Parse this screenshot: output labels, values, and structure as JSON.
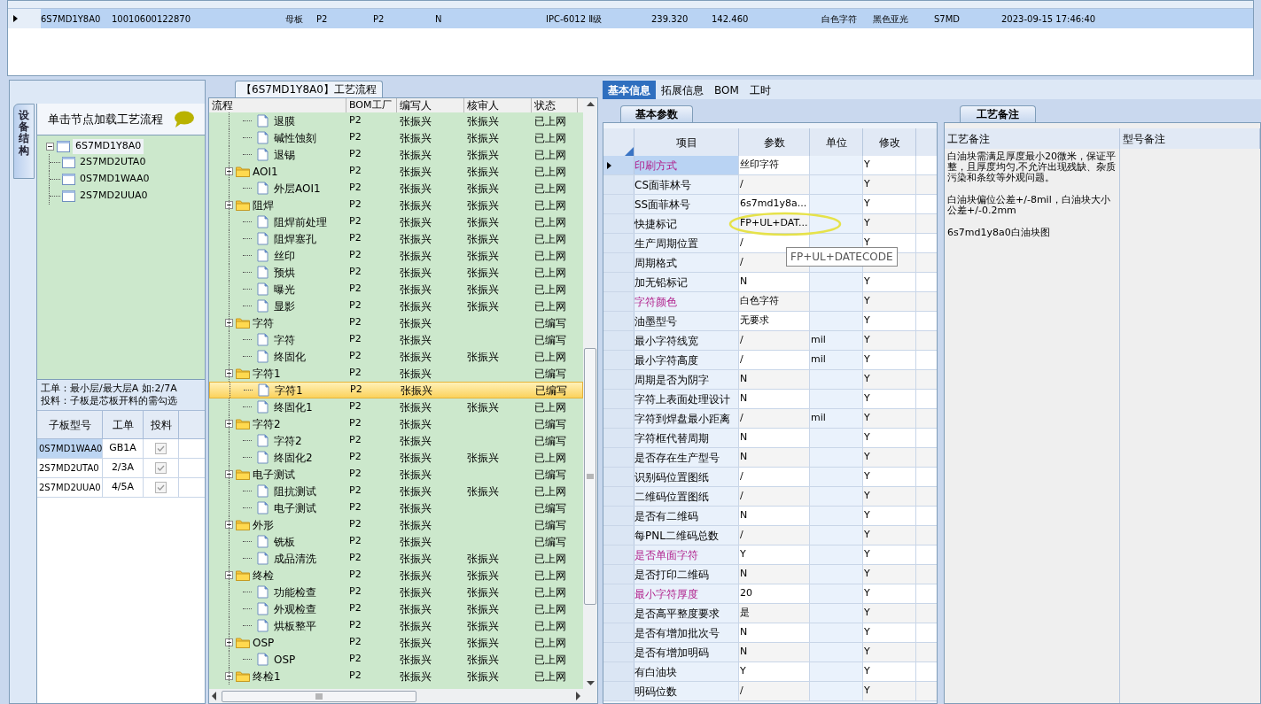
{
  "top_grid": {
    "rows": [
      {
        "selected": true,
        "cells": [
          "6S7MD1Y8A0",
          "10010600122870",
          "母板",
          "P2",
          "P2",
          "N",
          "IPC-6012 Ⅱ级",
          "239.320",
          "142.460",
          "白色字符",
          "黑色亚光",
          "S7MD",
          "2023-09-15 17:46:40"
        ]
      }
    ]
  },
  "left_panel": {
    "tab_label": "设备结构",
    "header": "单击节点加载工艺流程",
    "tree": {
      "label": "6S7MD1Y8A0",
      "expanded": true,
      "children": [
        {
          "label": "2S7MD2UTA0"
        },
        {
          "label": "0S7MD1WAA0"
        },
        {
          "label": "2S7MD2UUA0"
        }
      ]
    },
    "notes": [
      "工单：最小层/最大层A 如:2/7A",
      "投料：子板是芯板开料的需勾选"
    ],
    "subtable": {
      "columns": [
        "子板型号",
        "工单",
        "投料"
      ],
      "rows": [
        {
          "model": "0S7MD1WAA0",
          "order": "GB1A",
          "feed": true,
          "selected": true
        },
        {
          "model": "2S7MD2UTA0",
          "order": "2/3A",
          "feed": true,
          "selected": false
        },
        {
          "model": "2S7MD2UUA0",
          "order": "4/5A",
          "feed": true,
          "selected": false
        }
      ]
    }
  },
  "flow": {
    "title": "【6S7MD1Y8A0】工艺流程",
    "columns": [
      "流程",
      "BOM工厂",
      "编写人",
      "核审人",
      "状态"
    ],
    "rows": [
      {
        "kind": "step",
        "label": "退膜",
        "factory": "P2",
        "writer": "张振兴",
        "reviewer": "张振兴",
        "status": "已上网",
        "selected": false
      },
      {
        "kind": "step",
        "label": "碱性蚀刻",
        "factory": "P2",
        "writer": "张振兴",
        "reviewer": "张振兴",
        "status": "已上网",
        "selected": false
      },
      {
        "kind": "step",
        "label": "退锡",
        "factory": "P2",
        "writer": "张振兴",
        "reviewer": "张振兴",
        "status": "已上网",
        "selected": false
      },
      {
        "kind": "folder",
        "label": "AOI1",
        "factory": "P2",
        "writer": "张振兴",
        "reviewer": "张振兴",
        "status": "已上网",
        "selected": false,
        "expanded": true,
        "children": [
          {
            "kind": "step",
            "label": "外层AOI1",
            "factory": "P2",
            "writer": "张振兴",
            "reviewer": "张振兴",
            "status": "已上网",
            "selected": false
          }
        ]
      },
      {
        "kind": "folder",
        "label": "阻焊",
        "factory": "P2",
        "writer": "张振兴",
        "reviewer": "张振兴",
        "status": "已上网",
        "selected": false,
        "expanded": true,
        "children": [
          {
            "kind": "step",
            "label": "阻焊前处理",
            "factory": "P2",
            "writer": "张振兴",
            "reviewer": "张振兴",
            "status": "已上网",
            "selected": false
          },
          {
            "kind": "step",
            "label": "阻焊塞孔",
            "factory": "P2",
            "writer": "张振兴",
            "reviewer": "张振兴",
            "status": "已上网",
            "selected": false
          },
          {
            "kind": "step",
            "label": "丝印",
            "factory": "P2",
            "writer": "张振兴",
            "reviewer": "张振兴",
            "status": "已上网",
            "selected": false
          },
          {
            "kind": "step",
            "label": "预烘",
            "factory": "P2",
            "writer": "张振兴",
            "reviewer": "张振兴",
            "status": "已上网",
            "selected": false
          },
          {
            "kind": "step",
            "label": "曝光",
            "factory": "P2",
            "writer": "张振兴",
            "reviewer": "张振兴",
            "status": "已上网",
            "selected": false
          },
          {
            "kind": "step",
            "label": "显影",
            "factory": "P2",
            "writer": "张振兴",
            "reviewer": "张振兴",
            "status": "已上网",
            "selected": false
          }
        ]
      },
      {
        "kind": "folder",
        "label": "字符",
        "factory": "P2",
        "writer": "张振兴",
        "status": "已编写",
        "selected": false,
        "expanded": true,
        "children": [
          {
            "kind": "step",
            "label": "字符",
            "factory": "P2",
            "writer": "张振兴",
            "status": "已编写",
            "selected": false
          },
          {
            "kind": "step",
            "label": "终固化",
            "factory": "P2",
            "writer": "张振兴",
            "reviewer": "张振兴",
            "status": "已上网",
            "selected": false
          }
        ]
      },
      {
        "kind": "folder",
        "label": "字符1",
        "factory": "P2",
        "writer": "张振兴",
        "status": "已编写",
        "selected": false,
        "expanded": true,
        "children": [
          {
            "kind": "step",
            "label": "字符1",
            "factory": "P2",
            "writer": "张振兴",
            "status": "已编写",
            "selected": true
          },
          {
            "kind": "step",
            "label": "终固化1",
            "factory": "P2",
            "writer": "张振兴",
            "reviewer": "张振兴",
            "status": "已上网",
            "selected": false
          }
        ]
      },
      {
        "kind": "folder",
        "label": "字符2",
        "factory": "P2",
        "writer": "张振兴",
        "status": "已编写",
        "selected": false,
        "expanded": true,
        "children": [
          {
            "kind": "step",
            "label": "字符2",
            "factory": "P2",
            "writer": "张振兴",
            "status": "已编写",
            "selected": false
          },
          {
            "kind": "step",
            "label": "终固化2",
            "factory": "P2",
            "writer": "张振兴",
            "reviewer": "张振兴",
            "status": "已上网",
            "selected": false
          }
        ]
      },
      {
        "kind": "folder",
        "label": "电子测试",
        "factory": "P2",
        "writer": "张振兴",
        "status": "已编写",
        "selected": false,
        "expanded": true,
        "children": [
          {
            "kind": "step",
            "label": "阻抗测试",
            "factory": "P2",
            "writer": "张振兴",
            "reviewer": "张振兴",
            "status": "已上网",
            "selected": false
          },
          {
            "kind": "step",
            "label": "电子测试",
            "factory": "P2",
            "writer": "张振兴",
            "status": "已编写",
            "selected": false
          }
        ]
      },
      {
        "kind": "folder",
        "label": "外形",
        "factory": "P2",
        "writer": "张振兴",
        "status": "已编写",
        "selected": false,
        "expanded": true,
        "children": [
          {
            "kind": "step",
            "label": "铣板",
            "factory": "P2",
            "writer": "张振兴",
            "status": "已编写",
            "selected": false
          },
          {
            "kind": "step",
            "label": "成品清洗",
            "factory": "P2",
            "writer": "张振兴",
            "reviewer": "张振兴",
            "status": "已上网",
            "selected": false
          }
        ]
      },
      {
        "kind": "folder",
        "label": "终检",
        "factory": "P2",
        "writer": "张振兴",
        "reviewer": "张振兴",
        "status": "已上网",
        "selected": false,
        "expanded": true,
        "children": [
          {
            "kind": "step",
            "label": "功能检查",
            "factory": "P2",
            "writer": "张振兴",
            "reviewer": "张振兴",
            "status": "已上网",
            "selected": false
          },
          {
            "kind": "step",
            "label": "外观检查",
            "factory": "P2",
            "writer": "张振兴",
            "reviewer": "张振兴",
            "status": "已上网",
            "selected": false
          },
          {
            "kind": "step",
            "label": "烘板整平",
            "factory": "P2",
            "writer": "张振兴",
            "reviewer": "张振兴",
            "status": "已上网",
            "selected": false
          }
        ]
      },
      {
        "kind": "folder",
        "label": "OSP",
        "factory": "P2",
        "writer": "张振兴",
        "reviewer": "张振兴",
        "status": "已上网",
        "selected": false,
        "expanded": true,
        "children": [
          {
            "kind": "step",
            "label": "OSP",
            "factory": "P2",
            "writer": "张振兴",
            "reviewer": "张振兴",
            "status": "已上网",
            "selected": false
          }
        ]
      },
      {
        "kind": "folder",
        "label": "终检1",
        "factory": "P2",
        "writer": "张振兴",
        "reviewer": "张振兴",
        "status": "已上网",
        "selected": false,
        "expanded": true
      }
    ]
  },
  "detail": {
    "tabs": [
      {
        "label": "基本信息",
        "selected": true
      },
      {
        "label": "拓展信息",
        "selected": false
      },
      {
        "label": "BOM",
        "selected": false
      },
      {
        "label": "工时",
        "selected": false
      }
    ],
    "subtab": "基本参数",
    "columns": [
      "项目",
      "参数",
      "单位",
      "修改"
    ],
    "rows": [
      {
        "item": "印刷方式",
        "value": "丝印字符",
        "modify": "Y",
        "highlighted": true,
        "selected": true
      },
      {
        "item": "CS面菲林号",
        "value": "/",
        "modify": "Y",
        "highlighted": false,
        "selected": false
      },
      {
        "item": "SS面菲林号",
        "value": "6s7md1y8a...",
        "modify": "Y",
        "highlighted": false,
        "selected": false
      },
      {
        "item": "快捷标记",
        "value": "FP+UL+DAT...",
        "modify": "Y",
        "highlighted": false,
        "selected": false
      },
      {
        "item": "生产周期位置",
        "value": "/",
        "modify": "Y",
        "highlighted": false,
        "selected": false
      },
      {
        "item": "周期格式",
        "value": "/",
        "highlighted": false,
        "selected": false
      },
      {
        "item": "加无铅标记",
        "value": "N",
        "modify": "Y",
        "highlighted": false,
        "selected": false
      },
      {
        "item": "字符颜色",
        "value": "白色字符",
        "modify": "Y",
        "highlighted": true,
        "selected": false
      },
      {
        "item": "油墨型号",
        "value": "无要求",
        "modify": "Y",
        "highlighted": false,
        "selected": false
      },
      {
        "item": "最小字符线宽",
        "value": "/",
        "unit": "mil",
        "modify": "Y",
        "highlighted": false,
        "selected": false
      },
      {
        "item": "最小字符高度",
        "value": "/",
        "unit": "mil",
        "modify": "Y",
        "highlighted": false,
        "selected": false
      },
      {
        "item": "周期是否为阴字",
        "value": "N",
        "modify": "Y",
        "highlighted": false,
        "selected": false
      },
      {
        "item": "字符上表面处理设计",
        "value": "N",
        "modify": "Y",
        "highlighted": false,
        "selected": false
      },
      {
        "item": "字符到焊盘最小距离",
        "value": "/",
        "unit": "mil",
        "modify": "Y",
        "highlighted": false,
        "selected": false
      },
      {
        "item": "字符框代替周期",
        "value": "N",
        "modify": "Y",
        "highlighted": false,
        "selected": false
      },
      {
        "item": "是否存在生产型号",
        "value": "N",
        "modify": "Y",
        "highlighted": false,
        "selected": false
      },
      {
        "item": "识别码位置图纸",
        "value": "/",
        "modify": "Y",
        "highlighted": false,
        "selected": false
      },
      {
        "item": "二维码位置图纸",
        "value": "/",
        "modify": "Y",
        "highlighted": false,
        "selected": false
      },
      {
        "item": "是否有二维码",
        "value": "N",
        "modify": "Y",
        "highlighted": false,
        "selected": false
      },
      {
        "item": "每PNL二维码总数",
        "value": "/",
        "modify": "Y",
        "highlighted": false,
        "selected": false
      },
      {
        "item": "是否单面字符",
        "value": "Y",
        "modify": "Y",
        "highlighted": true,
        "selected": false
      },
      {
        "item": "是否打印二维码",
        "value": "N",
        "modify": "Y",
        "highlighted": false,
        "selected": false
      },
      {
        "item": "最小字符厚度",
        "value": "20",
        "modify": "Y",
        "highlighted": true,
        "selected": false
      },
      {
        "item": "是否高平整度要求",
        "value": "是",
        "modify": "Y",
        "highlighted": false,
        "selected": false
      },
      {
        "item": "是否有增加批次号",
        "value": "N",
        "modify": "Y",
        "highlighted": false,
        "selected": false
      },
      {
        "item": "是否有增加明码",
        "value": "N",
        "modify": "Y",
        "highlighted": false,
        "selected": false
      },
      {
        "item": "有白油块",
        "value": "Y",
        "modify": "Y",
        "highlighted": false,
        "selected": false
      },
      {
        "item": "明码位数",
        "value": "/",
        "modify": "Y",
        "highlighted": false,
        "selected": false
      }
    ],
    "tooltip": "FP+UL+DATECODE"
  },
  "notes_panel": {
    "tab": "工艺备注",
    "columns": [
      "工艺备注",
      "型号备注"
    ],
    "paragraphs": [
      "白油块需满足厚度最小20微米，保证平整，且厚度均匀,不允许出现残缺、杂质污染和条纹等外观问题。",
      "白油块偏位公差+/-8mil，白油块大小公差+/-0.2mm",
      "6s7md1y8a0白油块图"
    ]
  }
}
